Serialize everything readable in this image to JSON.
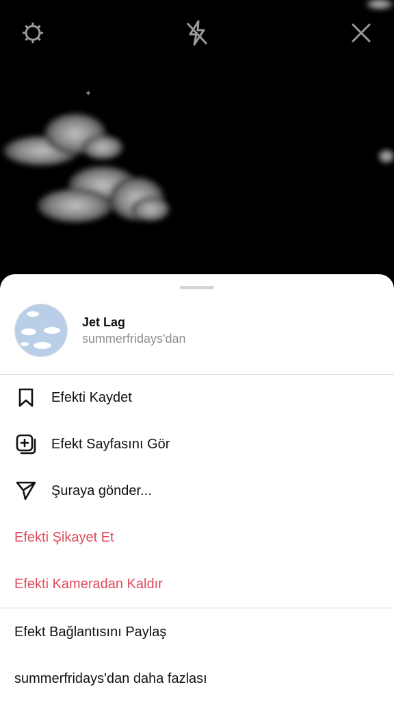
{
  "camera": {
    "icons": {
      "settings": "gear-icon",
      "flash": "flash-off-icon",
      "close": "close-icon"
    }
  },
  "effect": {
    "title": "Jet Lag",
    "creator": "summerfridays'dan"
  },
  "menu": {
    "save": {
      "label": "Efekti Kaydet",
      "icon": "bookmark-icon"
    },
    "view_page": {
      "label": "Efekt Sayfasını Gör",
      "icon": "effect-page-icon"
    },
    "send_to": {
      "label": "Şuraya gönder...",
      "icon": "send-icon"
    },
    "report": {
      "label": "Efekti Şikayet Et"
    },
    "remove": {
      "label": "Efekti Kameradan Kaldır"
    },
    "share_link": {
      "label": "Efekt Bağlantısını Paylaş"
    },
    "more_from": {
      "label": "summerfridays'dan daha fazlası"
    }
  },
  "colors": {
    "danger": "#e04a5c",
    "text": "#111111",
    "secondary": "#8e8e8e"
  }
}
